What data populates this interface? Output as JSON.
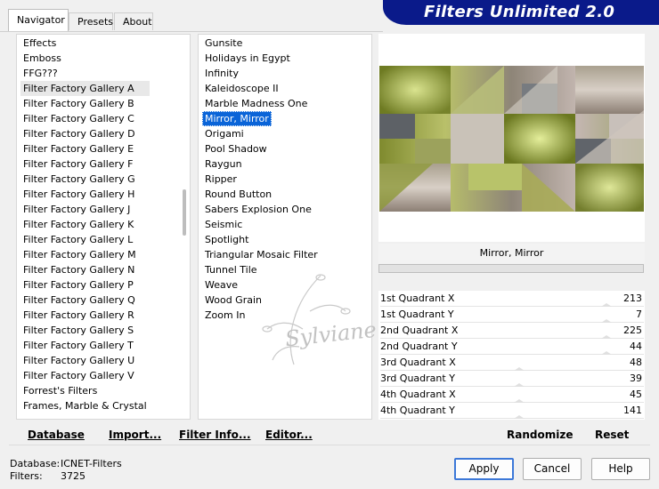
{
  "tabs": [
    {
      "label": "Navigator",
      "active": true
    },
    {
      "label": "Presets",
      "active": false
    },
    {
      "label": "About",
      "active": false
    }
  ],
  "banner": {
    "title": "Filters Unlimited 2.0",
    "color": "#0a1a8a"
  },
  "categories": {
    "items": [
      "Effects",
      "Emboss",
      "FFG???",
      "Filter Factory Gallery A",
      "Filter Factory Gallery B",
      "Filter Factory Gallery C",
      "Filter Factory Gallery D",
      "Filter Factory Gallery E",
      "Filter Factory Gallery F",
      "Filter Factory Gallery G",
      "Filter Factory Gallery H",
      "Filter Factory Gallery J",
      "Filter Factory Gallery K",
      "Filter Factory Gallery L",
      "Filter Factory Gallery M",
      "Filter Factory Gallery N",
      "Filter Factory Gallery P",
      "Filter Factory Gallery Q",
      "Filter Factory Gallery R",
      "Filter Factory Gallery S",
      "Filter Factory Gallery T",
      "Filter Factory Gallery U",
      "Filter Factory Gallery V",
      "Forrest's Filters",
      "Frames, Marble & Crystal"
    ],
    "highlighted": "Filter Factory Gallery A"
  },
  "filters": {
    "items": [
      "Gunsite",
      "Holidays in Egypt",
      "Infinity",
      "Kaleidoscope II",
      "Marble Madness One",
      "Mirror, Mirror",
      "Origami",
      "Pool Shadow",
      "Raygun",
      "Ripper",
      "Round Button",
      "Sabers Explosion One",
      "Seismic",
      "Spotlight",
      "Triangular Mosaic Filter",
      "Tunnel Tile",
      "Weave",
      "Wood Grain",
      "Zoom In"
    ],
    "selected": "Mirror, Mirror"
  },
  "preview": {
    "filter_name": "Mirror, Mirror"
  },
  "parameters": [
    {
      "name": "1st Quadrant X",
      "value": "213"
    },
    {
      "name": "1st Quadrant Y",
      "value": "7"
    },
    {
      "name": "2nd Quadrant X",
      "value": "225"
    },
    {
      "name": "2nd Quadrant Y",
      "value": "44"
    },
    {
      "name": "3rd Quadrant X",
      "value": "48"
    },
    {
      "name": "3rd Quadrant Y",
      "value": "39"
    },
    {
      "name": "4th Quadrant X",
      "value": "45"
    },
    {
      "name": "4th Quadrant Y",
      "value": "141"
    }
  ],
  "toolbar": {
    "database": "Database",
    "import": "Import...",
    "filter_info": "Filter Info...",
    "editor": "Editor...",
    "randomize": "Randomize",
    "reset": "Reset"
  },
  "status": {
    "database_label": "Database:",
    "database_value": "ICNET-Filters",
    "filters_label": "Filters:",
    "filters_value": "3725"
  },
  "buttons": {
    "apply": "Apply",
    "cancel": "Cancel",
    "help": "Help"
  },
  "watermark": "Sylviane"
}
